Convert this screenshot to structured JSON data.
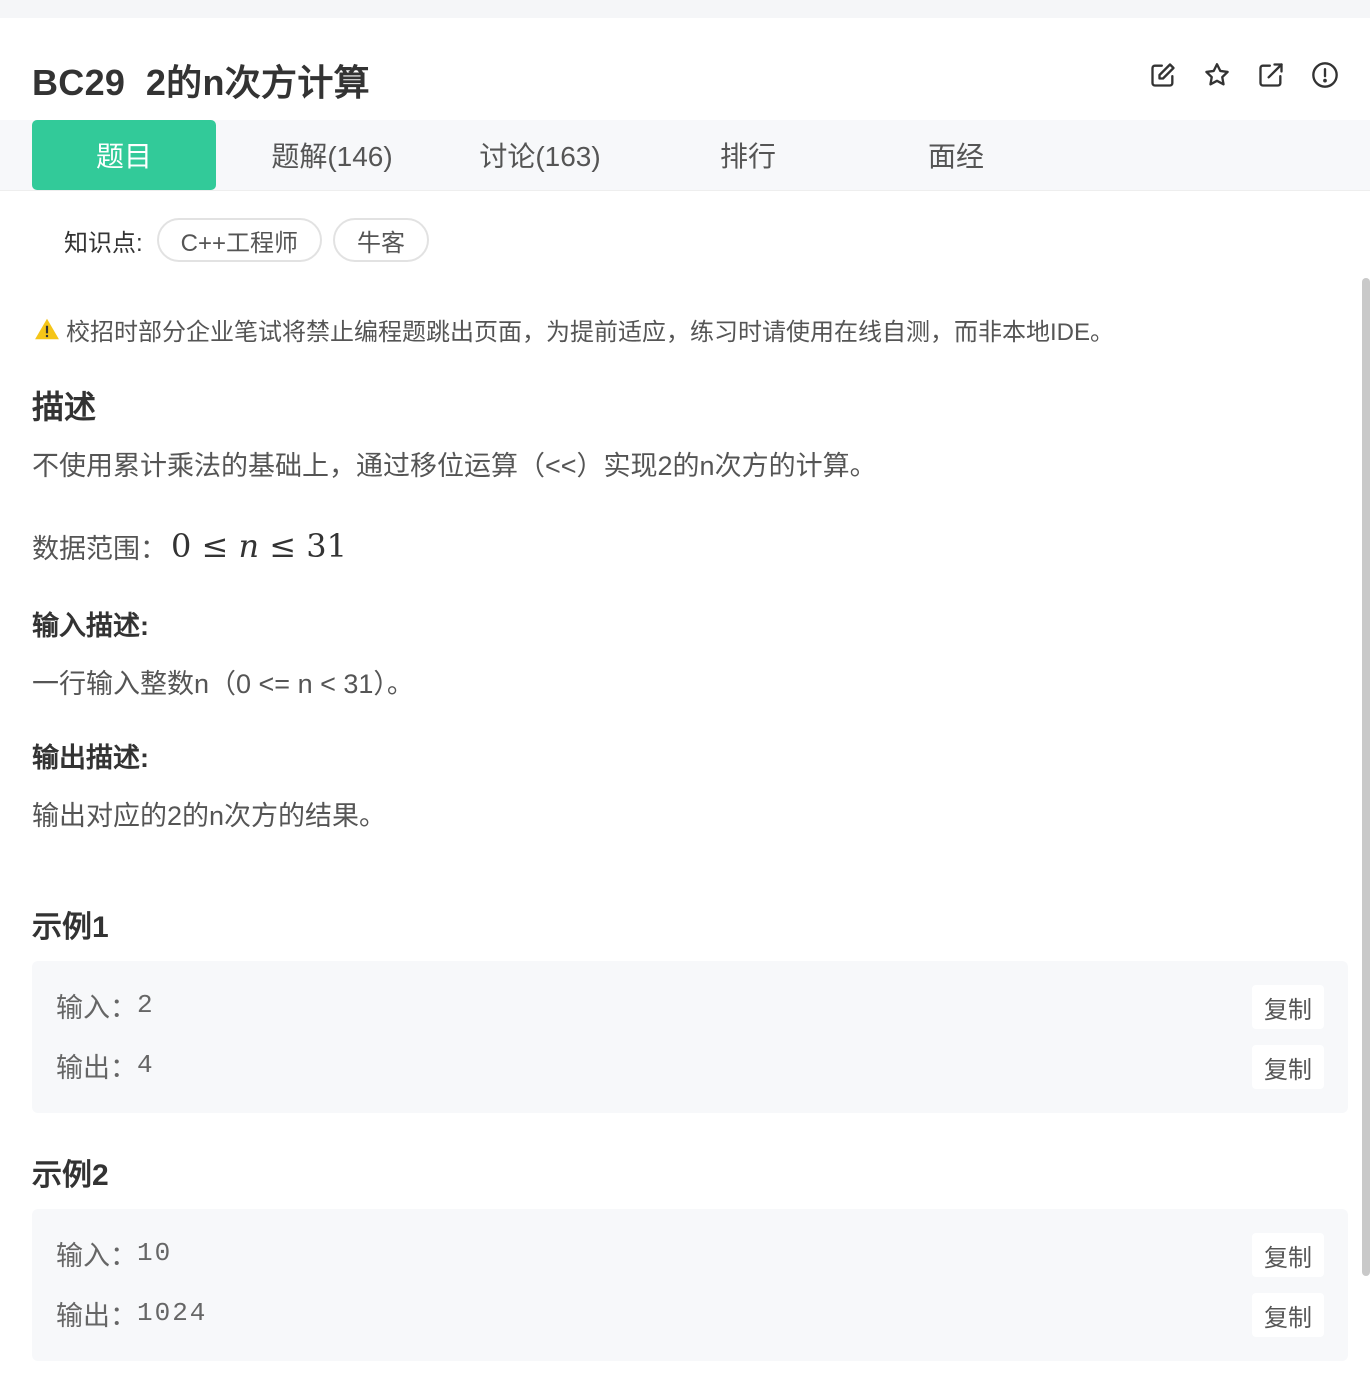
{
  "header": {
    "title": "BC29  2的n次方计算",
    "icons": [
      "edit-icon",
      "star-icon",
      "external-link-icon",
      "report-icon"
    ]
  },
  "tabs": [
    {
      "label": "题目",
      "active": true
    },
    {
      "label": "题解(146)",
      "active": false
    },
    {
      "label": "讨论(163)",
      "active": false
    },
    {
      "label": "排行",
      "active": false
    },
    {
      "label": "面经",
      "active": false
    }
  ],
  "knowledge": {
    "label": "知识点:",
    "tags": [
      "C++工程师",
      "牛客"
    ]
  },
  "notice": "校招时部分企业笔试将禁止编程题跳出页面，为提前适应，练习时请使用在线自测，而非本地IDE。",
  "description": {
    "heading": "描述",
    "text": "不使用累计乘法的基础上，通过移位运算（<<）实现2的n次方的计算。",
    "range_label": "数据范围：",
    "range_math": {
      "low": "0",
      "le1": "≤",
      "var": "n",
      "le2": "≤",
      "high": "31"
    }
  },
  "input_desc": {
    "heading": "输入描述:",
    "text": "一行输入整数n（0 <= n < 31）。"
  },
  "output_desc": {
    "heading": "输出描述:",
    "text": "输出对应的2的n次方的结果。"
  },
  "examples": [
    {
      "title": "示例1",
      "input_label": "输入：",
      "input": "2",
      "output_label": "输出：",
      "output": "4",
      "copy_label": "复制"
    },
    {
      "title": "示例2",
      "input_label": "输入：",
      "input": "10",
      "output_label": "输出：",
      "output": "1024",
      "copy_label": "复制"
    }
  ],
  "colors": {
    "accent": "#32ca99",
    "warning": "#f5c518",
    "text": "#333333",
    "muted": "#555555",
    "panel": "#f7f8fa"
  }
}
